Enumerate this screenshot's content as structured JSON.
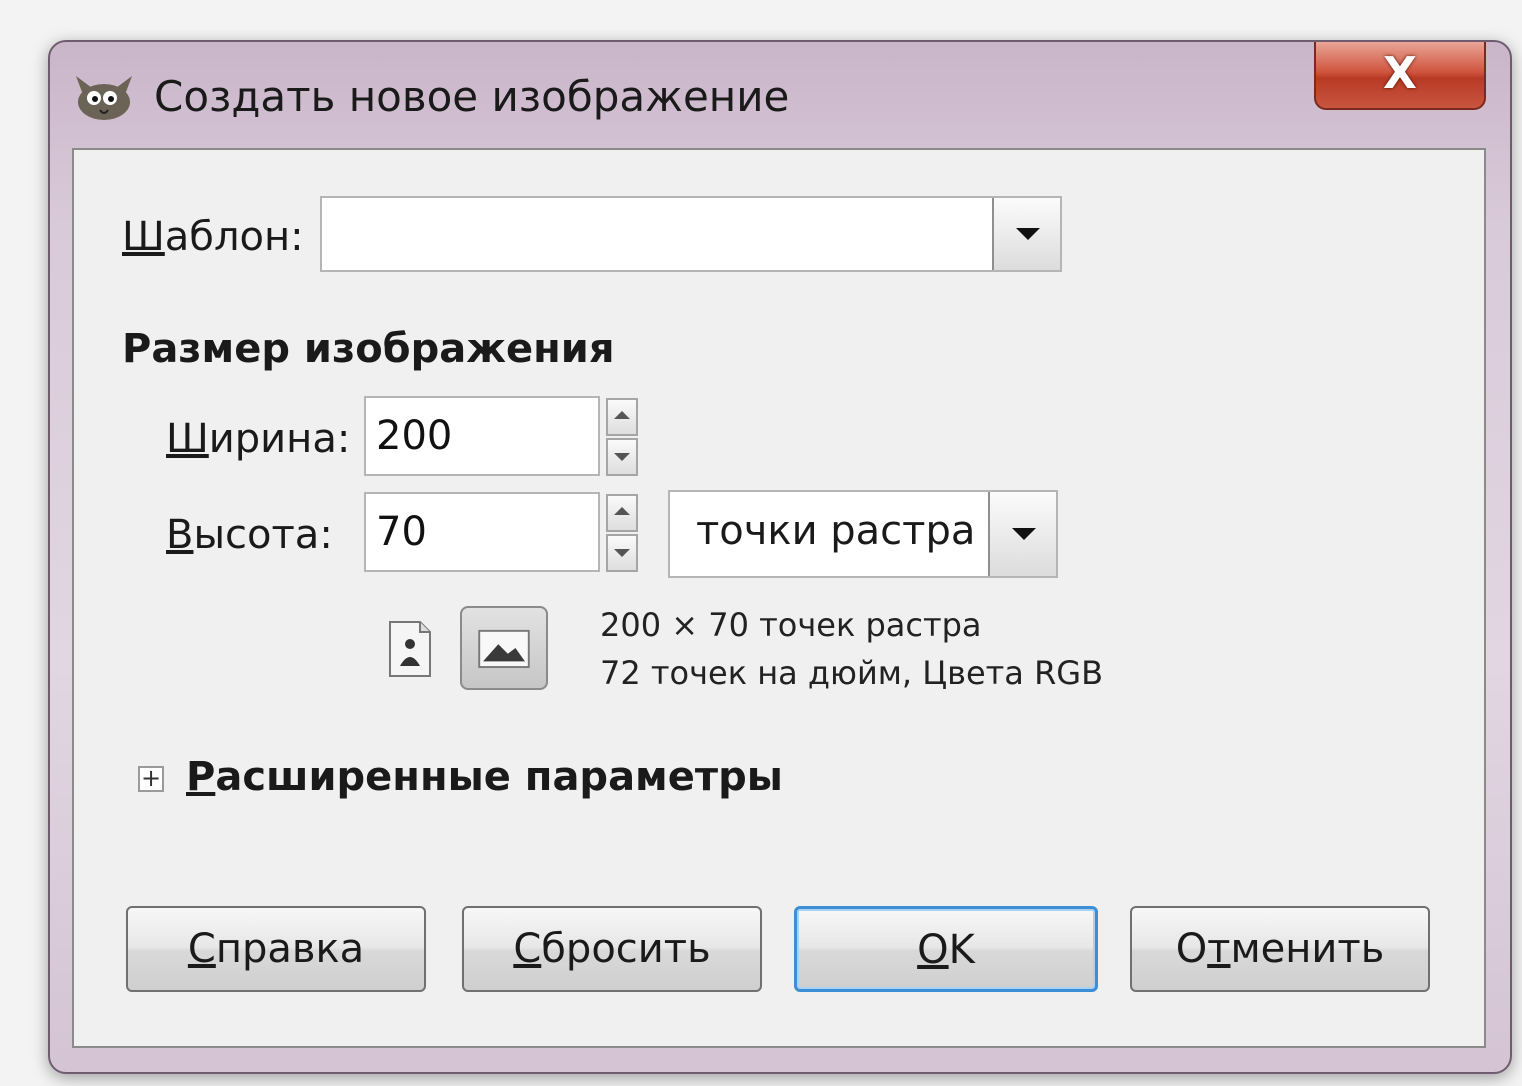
{
  "window": {
    "title": "Создать новое изображение",
    "close_label": "X"
  },
  "template": {
    "label_mnemonic": "Ш",
    "label_rest": "аблон:",
    "value": ""
  },
  "image_size": {
    "heading": "Размер изображения",
    "width_label_mnemonic": "Ш",
    "width_label_rest": "ирина:",
    "width_value": "200",
    "height_label_mnemonic": "В",
    "height_label_rest": "ысота:",
    "height_value": "70",
    "unit": "точки растра",
    "info_line1": "200 × 70 точек растра",
    "info_line2": "72 точек на дюйм, Цвета RGB"
  },
  "advanced": {
    "expander_symbol": "+",
    "label_mnemonic": "Р",
    "label_rest": "асширенные параметры"
  },
  "buttons": {
    "help_mnemonic": "С",
    "help_rest": "правка",
    "reset_mnemonic": "С",
    "reset_rest": "бросить",
    "ok_mnemonic": "O",
    "ok_rest": "K",
    "cancel_pre": "О",
    "cancel_mnemonic": "т",
    "cancel_rest": "менить"
  },
  "icons": {
    "app": "gimp-wilber-icon",
    "portrait": "portrait-orientation-icon",
    "landscape": "landscape-orientation-icon",
    "dropdown": "chevron-down-icon"
  },
  "colors": {
    "title_bar": "#d9cad9",
    "close_button": "#c9553e",
    "default_button_border": "#3c8fd6",
    "dialog_background": "#f0f0f0"
  }
}
